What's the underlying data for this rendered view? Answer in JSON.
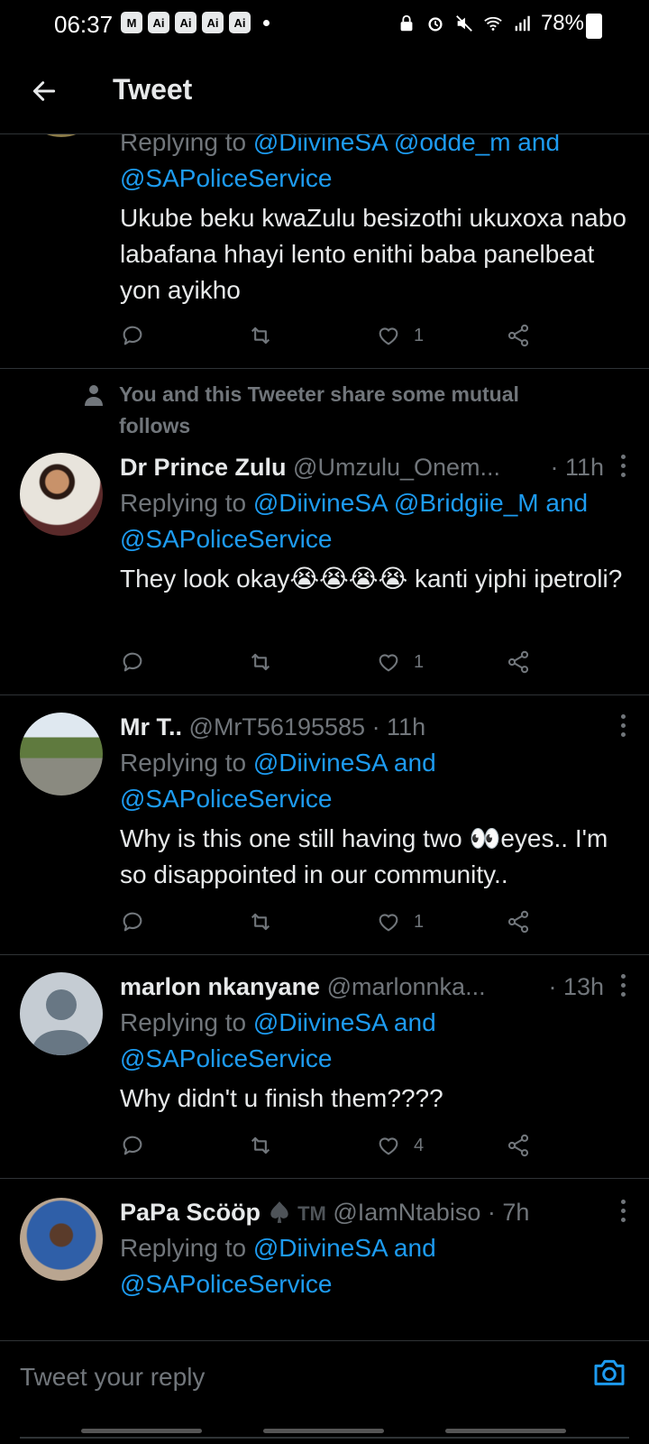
{
  "status_bar": {
    "time": "06:37",
    "notification_chips": [
      "M",
      "Ai",
      "Ai",
      "Ai",
      "Ai"
    ],
    "battery": "78%"
  },
  "header": {
    "title": "Tweet"
  },
  "tweets": [
    {
      "reply_prefix": "Replying to ",
      "mentions": [
        "@DiivineSA",
        "@odde_m"
      ],
      "and": " and ",
      "last_mention": "@SAPoliceService",
      "text": "Ukube beku kwaZulu besizothi ukuxoxa nabo labafana hhayi lento enithi baba panelbeat yon ayikho",
      "likes": "1"
    },
    {
      "social_context": "You and this Tweeter share some mutual follows",
      "display_name": "Dr Prince Zulu",
      "handle": "@Umzulu_Onem...",
      "time": "· 11h",
      "reply_prefix": "Replying to ",
      "mentions": [
        "@DiivineSA",
        "@Bridgiie_M"
      ],
      "and": " and ",
      "last_mention": "@SAPoliceService",
      "text": "They look okay😭😭😭😭 kanti yiphi ipetroli?",
      "likes": "1"
    },
    {
      "display_name": "Mr T..",
      "handle": "@MrT56195585",
      "time": "· 11h",
      "reply_prefix": "Replying to ",
      "mentions": [
        "@DiivineSA"
      ],
      "and": " and ",
      "last_mention": "@SAPoliceService",
      "text": "Why is this one still having two 👀eyes.. I'm so disappointed in our community..",
      "likes": "1"
    },
    {
      "display_name": "marlon nkanyane",
      "handle": "@marlonnka...",
      "time": "· 13h",
      "reply_prefix": "Replying to ",
      "mentions": [
        "@DiivineSA"
      ],
      "and": " and ",
      "last_mention": "@SAPoliceService",
      "text": "Why didn't u finish them????",
      "likes": "4"
    },
    {
      "display_name": "PaPa Scööp",
      "name_badge": "TM",
      "handle": "@IamNtabiso",
      "time": "· 7h",
      "reply_prefix": "Replying to ",
      "mentions": [
        "@DiivineSA"
      ],
      "and": " and ",
      "last_mention": "@SAPoliceService"
    }
  ],
  "composer": {
    "placeholder": "Tweet your reply"
  },
  "colors": {
    "background": "#000000",
    "link": "#1d9bf0",
    "muted": "#71767b",
    "text": "#e7e9ea",
    "divider": "#2f3336"
  },
  "icons": [
    "back-arrow-icon",
    "reply-icon",
    "retweet-icon",
    "like-icon",
    "share-icon",
    "more-icon",
    "person-icon",
    "camera-icon"
  ]
}
